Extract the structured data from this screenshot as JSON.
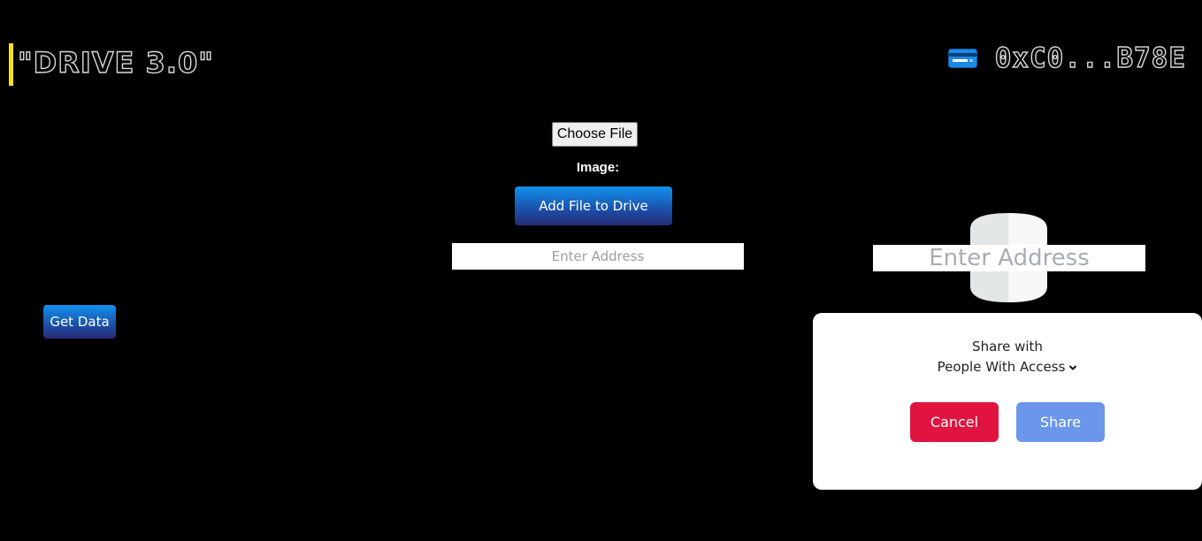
{
  "header": {
    "brand": "\"DRIVE 3.0\"",
    "wallet_address": "0xC0...B78E"
  },
  "upload": {
    "choose_file_label": "Choose File",
    "image_label": "Image:",
    "add_button_label": "Add File to Drive",
    "address_placeholder": "Enter Address"
  },
  "sidebar": {
    "get_data_label": "Get Data"
  },
  "share_panel": {
    "address_placeholder": "Enter Address",
    "share_with_label": "Share with",
    "selected_option": "People With Access",
    "cancel_label": "Cancel",
    "share_label": "Share"
  },
  "colors": {
    "accent_bar": "#f5e31a",
    "cancel": "#e0143f",
    "share": "#6b96ea"
  }
}
